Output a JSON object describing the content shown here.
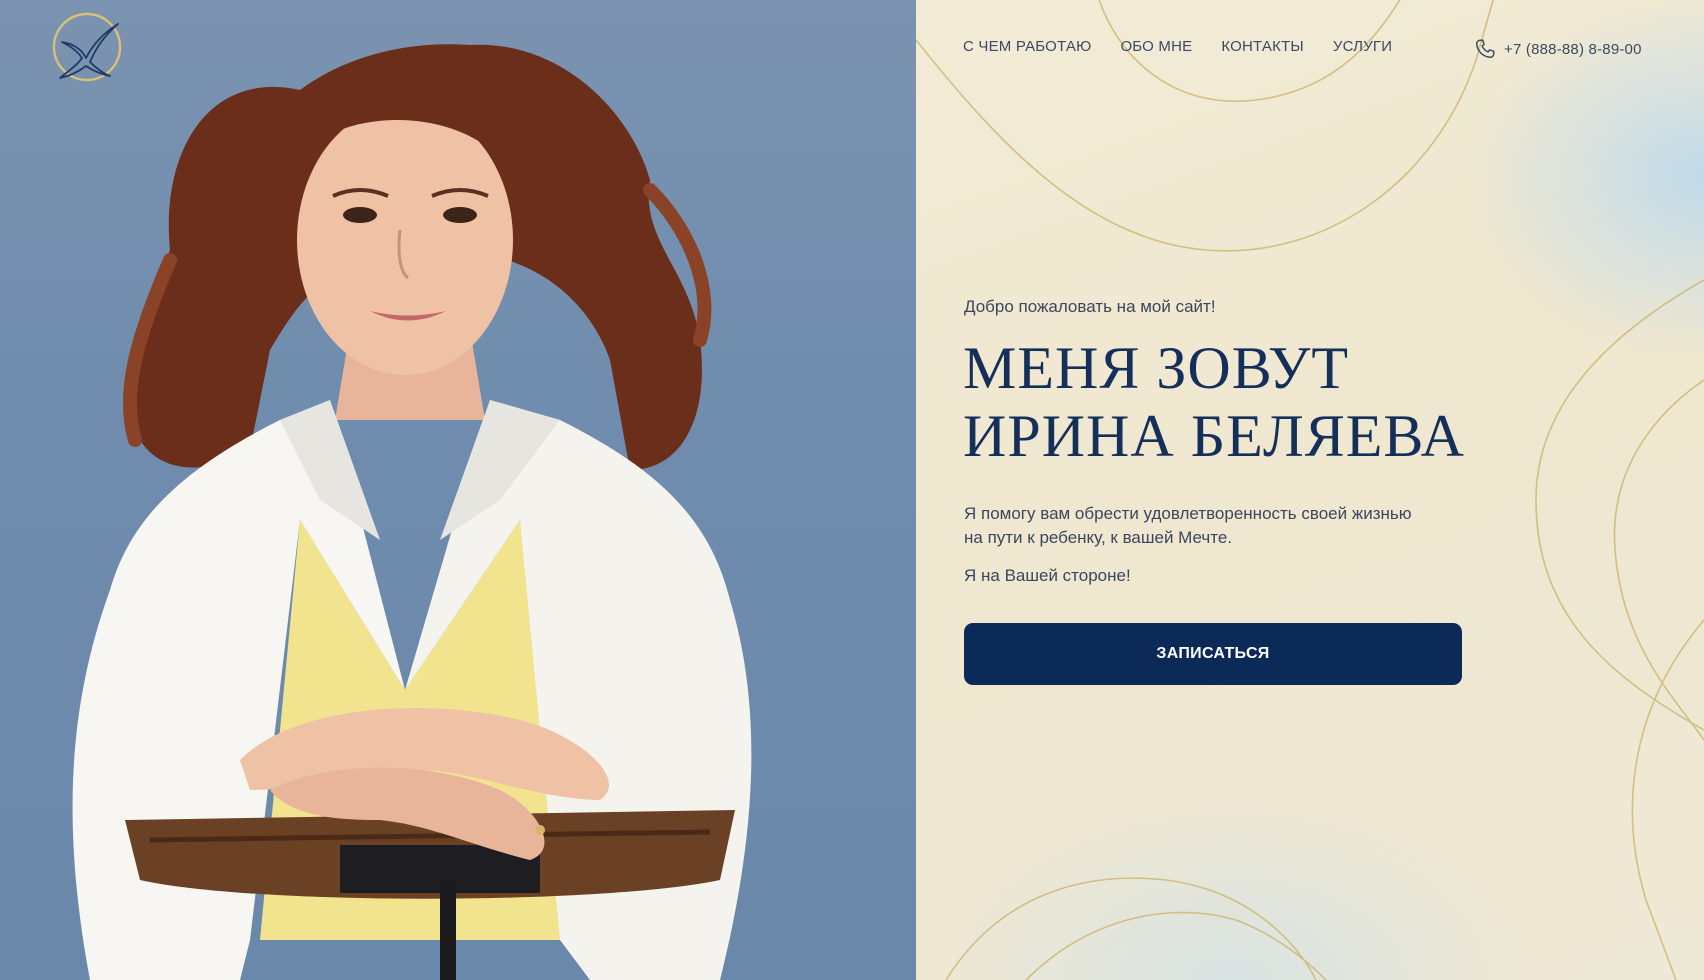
{
  "nav": {
    "items": [
      {
        "label": "С ЧЕМ РАБОТАЮ"
      },
      {
        "label": "ОБО МНЕ"
      },
      {
        "label": "КОНТАКТЫ"
      },
      {
        "label": "УСЛУГИ"
      }
    ],
    "phone": "+7 (888-88) 8-89-00",
    "phone_icon": "phone-icon"
  },
  "logo": {
    "icon": "bird-logo-icon"
  },
  "hero": {
    "welcome": "Добро пожаловать на мой сайт!",
    "title_line1": "МЕНЯ ЗОВУТ",
    "title_line2": "ИРИНА БЕЛЯЕВА",
    "description_line1": "Я помогу вам обрести удовлетворенность своей жизнью",
    "description_line2": "на пути к ребенку, к вашей Мечте.",
    "tagline": "Я на Вашей стороне!",
    "cta_label": "ЗАПИСАТЬСЯ"
  },
  "colors": {
    "accent_navy": "#0c2a58",
    "title_navy": "#14305a",
    "gold_line": "#cdb874",
    "photo_background": "#6f8cae"
  }
}
